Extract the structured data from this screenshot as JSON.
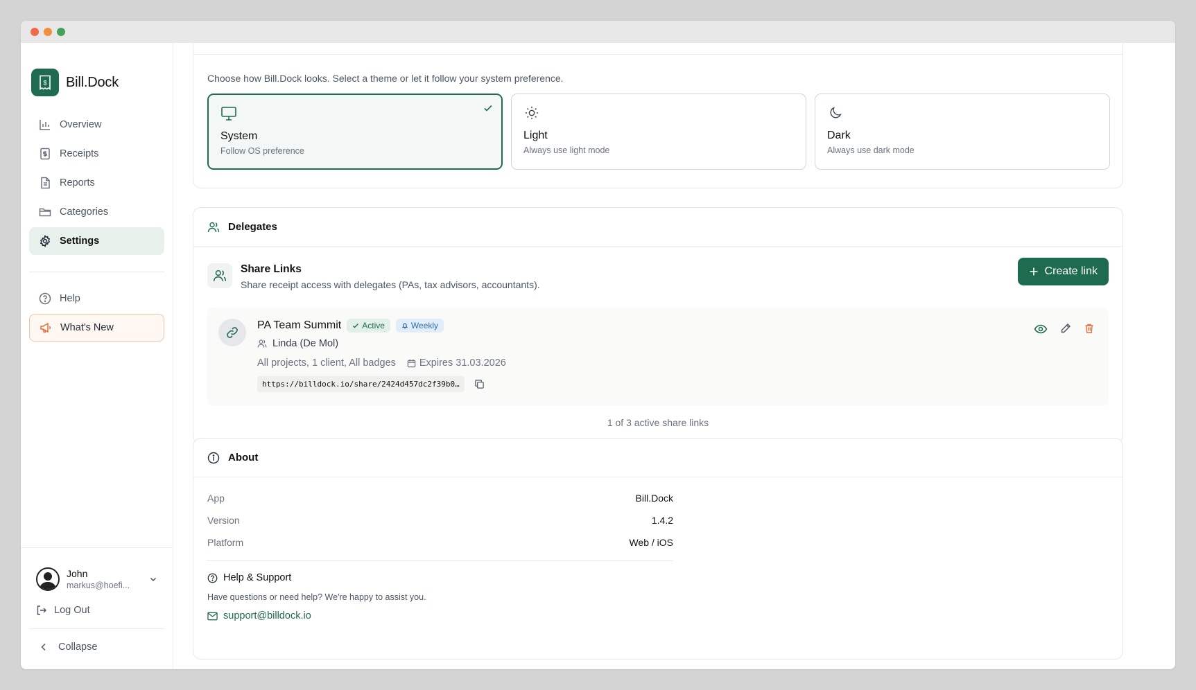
{
  "window": {
    "dots": [
      "#ee6a4b",
      "#ef8f3f",
      "#45a05b"
    ]
  },
  "brand": {
    "name": "Bill.Dock",
    "color": "#1f6b4f"
  },
  "sidebar": {
    "items": [
      {
        "label": "Overview",
        "icon": "bar-chart-icon"
      },
      {
        "label": "Receipts",
        "icon": "receipt-icon"
      },
      {
        "label": "Reports",
        "icon": "document-icon"
      },
      {
        "label": "Categories",
        "icon": "folder-icon"
      },
      {
        "label": "Settings",
        "icon": "gear-icon",
        "active": true
      }
    ],
    "secondary": [
      {
        "label": "Help",
        "icon": "help-circle-icon"
      },
      {
        "label": "What's New",
        "icon": "megaphone-icon"
      }
    ],
    "user": {
      "name": "John",
      "email": "markus@hoefi..."
    },
    "logout_label": "Log Out",
    "collapse_label": "Collapse"
  },
  "appearance": {
    "description": "Choose how Bill.Dock looks. Select a theme or let it follow your system preference.",
    "themes": [
      {
        "label": "System",
        "sub": "Follow OS preference",
        "icon": "monitor-icon",
        "selected": true
      },
      {
        "label": "Light",
        "sub": "Always use light mode",
        "icon": "sun-icon"
      },
      {
        "label": "Dark",
        "sub": "Always use dark mode",
        "icon": "moon-icon"
      }
    ]
  },
  "delegates": {
    "title": "Delegates",
    "share_title": "Share Links",
    "share_sub": "Share receipt access with delegates (PAs, tax advisors, accountants).",
    "create_label": "Create link",
    "link": {
      "title": "PA Team Summit",
      "status": "Active",
      "frequency": "Weekly",
      "person": "Linda (De Mol)",
      "scope": "All projects, 1 client, All badges",
      "expires": "Expires 31.03.2026",
      "url": "https://billdock.io/share/2424d457dc2f39b0…"
    },
    "count": "1 of 3 active share links"
  },
  "about": {
    "title": "About",
    "rows": [
      {
        "k": "App",
        "v": "Bill.Dock"
      },
      {
        "k": "Version",
        "v": "1.4.2"
      },
      {
        "k": "Platform",
        "v": "Web / iOS"
      }
    ],
    "help_title": "Help & Support",
    "help_sub": "Have questions or need help? We're happy to assist you.",
    "support_email": "support@billdock.io"
  }
}
